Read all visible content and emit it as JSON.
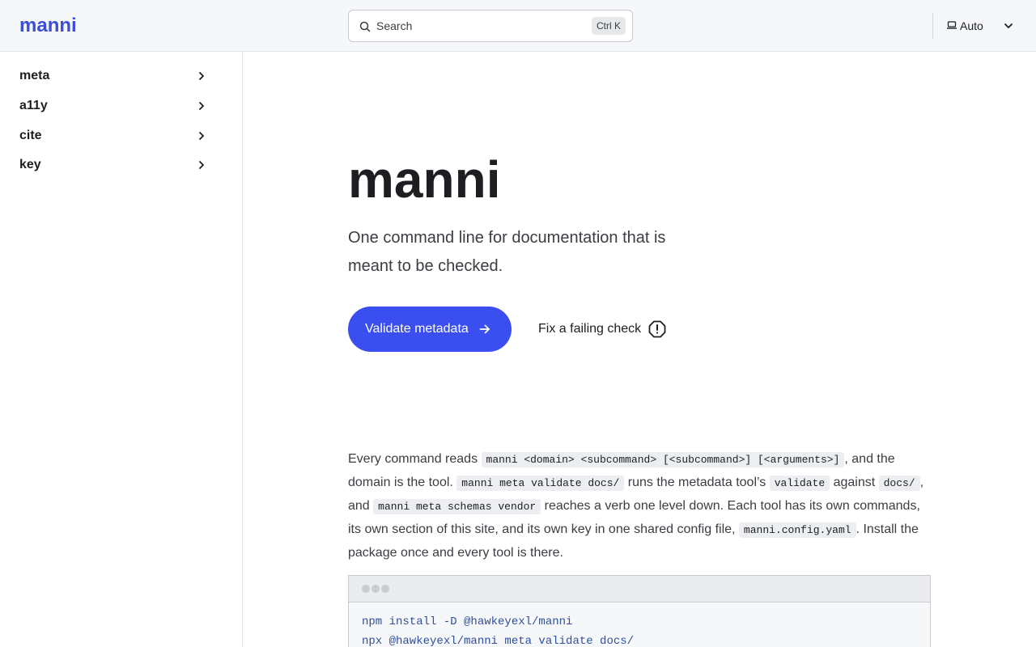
{
  "header": {
    "logo": "manni",
    "search_placeholder": "Search",
    "search_shortcut": "Ctrl K",
    "theme_label": "Auto"
  },
  "sidebar": {
    "items": [
      {
        "label": "meta"
      },
      {
        "label": "a11y"
      },
      {
        "label": "cite"
      },
      {
        "label": "key"
      }
    ]
  },
  "hero": {
    "title": "manni",
    "subtitle": "One command line for documentation that is meant to be checked.",
    "primary_button": "Validate metadata",
    "secondary_button": "Fix a failing check"
  },
  "intro": {
    "t1": "Every command reads ",
    "c1": "manni <domain> <subcommand> [<subcommand>] [<arguments>]",
    "t2": ", and the domain is the tool. ",
    "c2": "manni meta validate docs/",
    "t3": " runs the metadata tool’s ",
    "c3": "validate",
    "t4": " against ",
    "c4": "docs/",
    "t5": ", and ",
    "c5": "manni meta schemas vendor",
    "t6": " reaches a verb one level down. Each tool has its own commands, its own section of this site, and its own key in one shared config file, ",
    "c6": "manni.config.yaml",
    "t7": ". Install the package once and every tool is there."
  },
  "code": {
    "lines": [
      "npm install -D @hawkeyexl/manni",
      "npx @hawkeyexl/manni meta validate docs/"
    ]
  },
  "colors": {
    "brand": "#3b4ed8",
    "primary_button": "#3b4ef0",
    "code_text": "#2f4f9e"
  }
}
